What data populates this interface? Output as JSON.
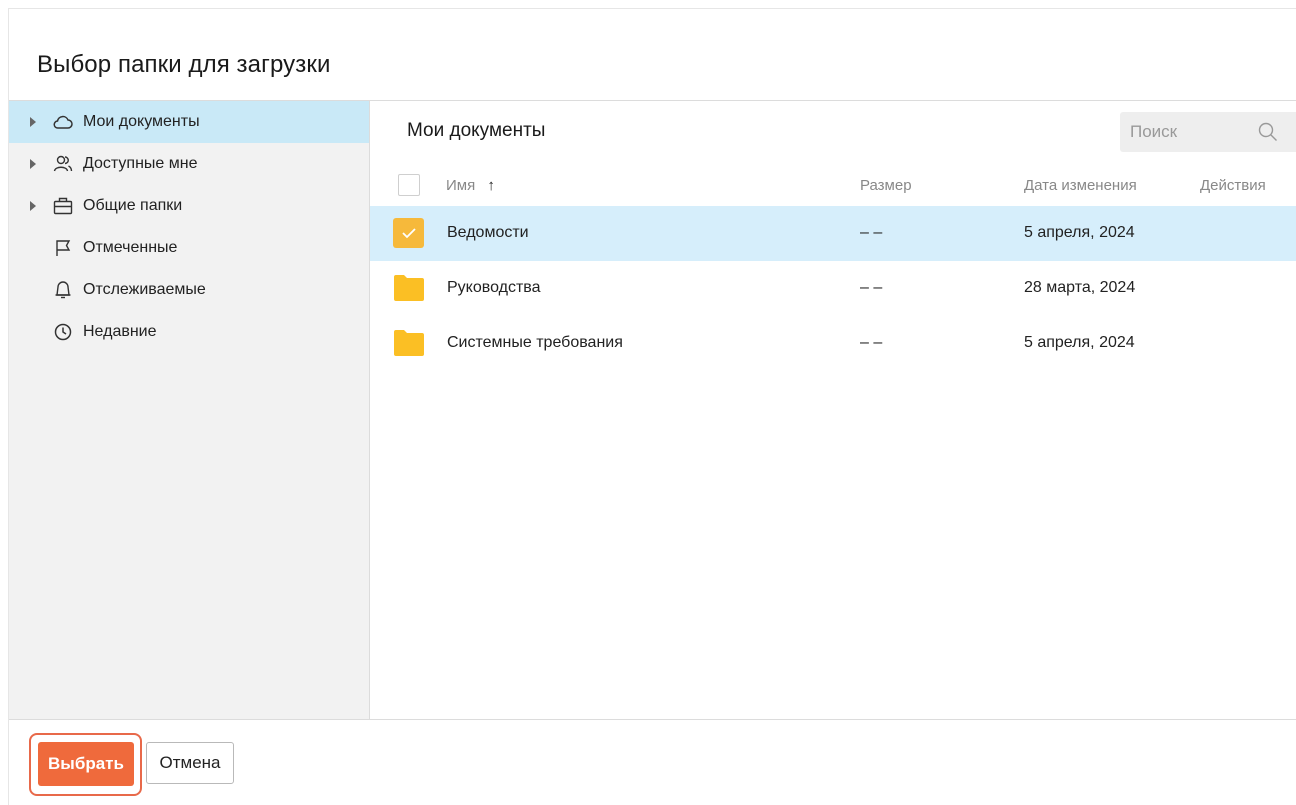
{
  "dialog": {
    "title": "Выбор папки для загрузки"
  },
  "sidebar": {
    "items": [
      {
        "label": "Мои документы",
        "icon": "cloud-icon",
        "expandable": true,
        "selected": true
      },
      {
        "label": "Доступные мне",
        "icon": "users-icon",
        "expandable": true,
        "selected": false
      },
      {
        "label": "Общие папки",
        "icon": "briefcase-icon",
        "expandable": true,
        "selected": false
      },
      {
        "label": "Отмеченные",
        "icon": "flag-icon",
        "expandable": false,
        "selected": false
      },
      {
        "label": "Отслеживаемые",
        "icon": "bell-icon",
        "expandable": false,
        "selected": false
      },
      {
        "label": "Недавние",
        "icon": "clock-icon",
        "expandable": false,
        "selected": false
      }
    ]
  },
  "main": {
    "title": "Мои документы",
    "search": {
      "placeholder": "Поиск",
      "value": ""
    },
    "columns": {
      "name": "Имя",
      "sort_indicator": "↑",
      "size": "Размер",
      "modified": "Дата изменения",
      "actions": "Действия"
    },
    "rows": [
      {
        "name": "Ведомости",
        "size": "– –",
        "modified": "5 апреля, 2024",
        "selected": true
      },
      {
        "name": "Руководства",
        "size": "– –",
        "modified": "28 марта, 2024",
        "selected": false
      },
      {
        "name": "Системные требования",
        "size": "– –",
        "modified": "5 апреля, 2024",
        "selected": false
      }
    ]
  },
  "footer": {
    "select_label": "Выбрать",
    "cancel_label": "Отмена"
  },
  "colors": {
    "accent_button": "#ef6a3c",
    "selected_nav": "#c9e9f7",
    "selected_row": "#d6eefb",
    "folder": "#fbbf24",
    "checkbox_checked": "#f6b93b"
  }
}
